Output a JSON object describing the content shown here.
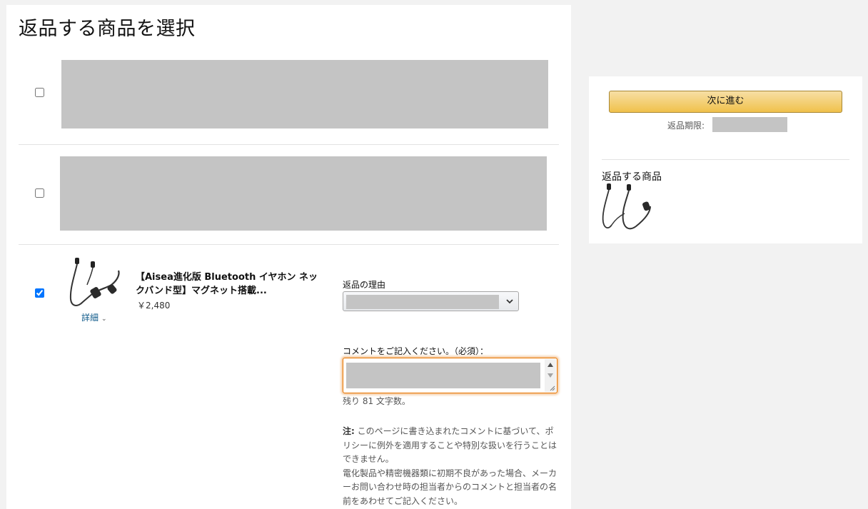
{
  "page": {
    "title": "返品する商品を選択"
  },
  "items": [
    {
      "checked": false
    },
    {
      "checked": false
    },
    {
      "checked": true,
      "title": "【Aisea進化版 Bluetooth イヤホン ネックバンド型】マグネット搭載...",
      "price": "￥2,480",
      "details_label": "詳細",
      "reason_label": "返品の理由",
      "comment_label": "コメントをご記入ください。（必須）：",
      "chars_left": "残り 81 文字数。",
      "note_prefix": "注:",
      "note_text": "このページに書き込まれたコメントに基づいて、ポリシーに例外を適用することや特別な扱いを行うことはできません。",
      "note_text_2": "電化製品や精密機器類に初期不良があった場合、メーカーお問い合わせ時の担当者からのコメントと担当者の名前をあわせてご記入ください。"
    }
  ],
  "sidebar": {
    "next_button": "次に進む",
    "deadline_label": "返品期限:",
    "items_heading": "返品する商品"
  },
  "colors": {
    "accent_button": "#f0c14b",
    "focus_border": "#e77600",
    "link": "#0f5a8a",
    "redacted": "#c4c4c4"
  },
  "icons": [
    "earphones-product-image",
    "chevron-down-icon",
    "scroll-up-arrow-icon",
    "scroll-down-arrow-icon",
    "resize-grip-icon"
  ]
}
